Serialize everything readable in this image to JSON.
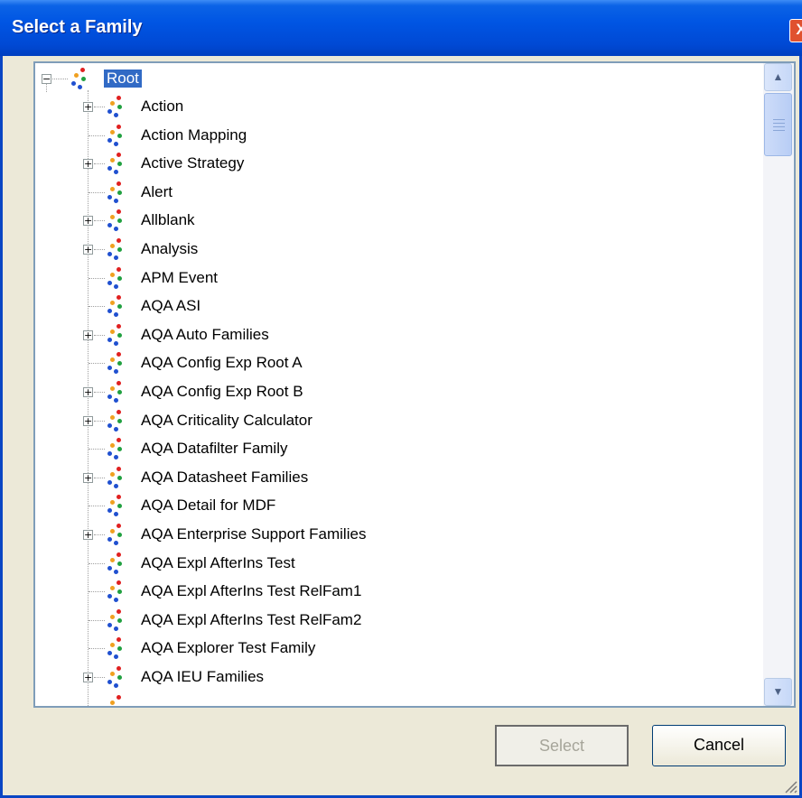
{
  "window": {
    "title": "Select a Family",
    "close_label": "X"
  },
  "tree": {
    "root_label": "Root",
    "items": [
      {
        "label": "Action",
        "expandable": true
      },
      {
        "label": "Action Mapping",
        "expandable": false
      },
      {
        "label": "Active Strategy",
        "expandable": true
      },
      {
        "label": "Alert",
        "expandable": false
      },
      {
        "label": "Allblank",
        "expandable": true
      },
      {
        "label": "Analysis",
        "expandable": true
      },
      {
        "label": "APM Event",
        "expandable": false
      },
      {
        "label": "AQA ASI",
        "expandable": false
      },
      {
        "label": "AQA Auto Families",
        "expandable": true
      },
      {
        "label": "AQA Config Exp Root A",
        "expandable": false
      },
      {
        "label": "AQA Config Exp Root B",
        "expandable": true
      },
      {
        "label": "AQA Criticality Calculator",
        "expandable": true
      },
      {
        "label": "AQA Datafilter Family",
        "expandable": false
      },
      {
        "label": "AQA Datasheet Families",
        "expandable": true
      },
      {
        "label": "AQA Detail for MDF",
        "expandable": false
      },
      {
        "label": "AQA Enterprise Support Families",
        "expandable": true
      },
      {
        "label": "AQA Expl AfterIns Test",
        "expandable": false
      },
      {
        "label": "AQA Expl AfterIns Test RelFam1",
        "expandable": false
      },
      {
        "label": "AQA Expl AfterIns Test RelFam2",
        "expandable": false
      },
      {
        "label": "AQA Explorer Test Family",
        "expandable": false
      },
      {
        "label": "AQA IEU Families",
        "expandable": true
      }
    ]
  },
  "buttons": {
    "select_label": "Select",
    "cancel_label": "Cancel"
  },
  "colors": {
    "title_bar": "#0055e3",
    "selection": "#316ac5",
    "dialog_bg": "#ece9d8"
  }
}
